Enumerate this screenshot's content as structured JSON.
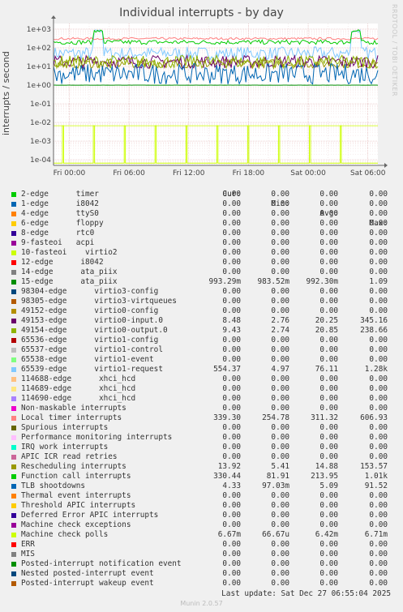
{
  "watermark": "RRDTOOL / TOBI OETIKER",
  "footer": {
    "last_update": "Last update: Sat Dec 27 06:55:04 2025",
    "munin": "Munin 2.0.57"
  },
  "legend_headers": [
    "Cur:",
    "Min:",
    "Avg:",
    "Max:"
  ],
  "chart_data": {
    "type": "line",
    "title": "Individual interrupts - by day",
    "ylabel": "interrupts / second",
    "xlabel": "",
    "yscale": "log",
    "ylim": [
      5e-05,
      2000
    ],
    "yticks": [
      "1e-04",
      "1e-03",
      "1e-02",
      "1e-01",
      "1e+00",
      "1e+01",
      "1e+02",
      "1e+03"
    ],
    "x_range": [
      "Thu 22:25",
      "Sat 07:00"
    ],
    "xticks": [
      "Fri 00:00",
      "Fri 06:00",
      "Fri 12:00",
      "Fri 18:00",
      "Sat 00:00",
      "Sat 06:00"
    ],
    "grid": true,
    "legend_placement": "bottom",
    "series": [
      {
        "name": "2-edge      timer",
        "color": "#00cc00",
        "cur": "0.00",
        "min": "0.00",
        "avg": "0.00",
        "max": "0.00"
      },
      {
        "name": "1-edge      i8042",
        "color": "#0066b3",
        "cur": "0.00",
        "min": "0.00",
        "avg": "0.00",
        "max": "0.00"
      },
      {
        "name": "4-edge      ttyS0",
        "color": "#ff8000",
        "cur": "0.00",
        "min": "0.00",
        "avg": "0.00",
        "max": "0.00"
      },
      {
        "name": "6-edge      floppy",
        "color": "#ffcc00",
        "cur": "0.00",
        "min": "0.00",
        "avg": "0.00",
        "max": "0.00"
      },
      {
        "name": "8-edge      rtc0",
        "color": "#330099",
        "cur": "0.00",
        "min": "0.00",
        "avg": "0.00",
        "max": "0.00"
      },
      {
        "name": "9-fasteoi   acpi",
        "color": "#990099",
        "cur": "0.00",
        "min": "0.00",
        "avg": "0.00",
        "max": "0.00"
      },
      {
        "name": "10-fasteoi    virtio2",
        "color": "#ccff00",
        "cur": "0.00",
        "min": "0.00",
        "avg": "0.00",
        "max": "0.00"
      },
      {
        "name": "12-edge      i8042",
        "color": "#ff0000",
        "cur": "0.00",
        "min": "0.00",
        "avg": "0.00",
        "max": "0.00"
      },
      {
        "name": "14-edge      ata_piix",
        "color": "#808080",
        "cur": "0.00",
        "min": "0.00",
        "avg": "0.00",
        "max": "0.00"
      },
      {
        "name": "15-edge      ata_piix",
        "color": "#008f00",
        "cur": "993.29m",
        "min": "983.52m",
        "avg": "992.30m",
        "max": "1.09"
      },
      {
        "name": "98304-edge      virtio3-config",
        "color": "#00487d",
        "cur": "0.00",
        "min": "0.00",
        "avg": "0.00",
        "max": "0.00"
      },
      {
        "name": "98305-edge      virtio3-virtqueues",
        "color": "#b35a00",
        "cur": "0.00",
        "min": "0.00",
        "avg": "0.00",
        "max": "0.00"
      },
      {
        "name": "49152-edge      virtio0-config",
        "color": "#b38f00",
        "cur": "0.00",
        "min": "0.00",
        "avg": "0.00",
        "max": "0.00"
      },
      {
        "name": "49153-edge      virtio0-input.0",
        "color": "#6b006b",
        "cur": "8.48",
        "min": "2.76",
        "avg": "20.25",
        "max": "345.16"
      },
      {
        "name": "49154-edge      virtio0-output.0",
        "color": "#8fb300",
        "cur": "9.43",
        "min": "2.74",
        "avg": "20.85",
        "max": "238.66"
      },
      {
        "name": "65536-edge      virtio1-config",
        "color": "#b30000",
        "cur": "0.00",
        "min": "0.00",
        "avg": "0.00",
        "max": "0.00"
      },
      {
        "name": "65537-edge      virtio1-control",
        "color": "#bebebe",
        "cur": "0.00",
        "min": "0.00",
        "avg": "0.00",
        "max": "0.00"
      },
      {
        "name": "65538-edge      virtio1-event",
        "color": "#80ff80",
        "cur": "0.00",
        "min": "0.00",
        "avg": "0.00",
        "max": "0.00"
      },
      {
        "name": "65539-edge      virtio1-request",
        "color": "#80c9ff",
        "cur": "554.37",
        "min": "4.97",
        "avg": "76.11",
        "max": "1.28k"
      },
      {
        "name": "114688-edge      xhci_hcd",
        "color": "#ffc080",
        "cur": "0.00",
        "min": "0.00",
        "avg": "0.00",
        "max": "0.00"
      },
      {
        "name": "114689-edge      xhci_hcd",
        "color": "#ffe680",
        "cur": "0.00",
        "min": "0.00",
        "avg": "0.00",
        "max": "0.00"
      },
      {
        "name": "114690-edge      xhci_hcd",
        "color": "#aa80ff",
        "cur": "0.00",
        "min": "0.00",
        "avg": "0.00",
        "max": "0.00"
      },
      {
        "name": "Non-maskable interrupts",
        "color": "#ee00cc",
        "cur": "0.00",
        "min": "0.00",
        "avg": "0.00",
        "max": "0.00"
      },
      {
        "name": "Local timer interrupts",
        "color": "#ff8080",
        "cur": "339.30",
        "min": "254.78",
        "avg": "311.32",
        "max": "606.93"
      },
      {
        "name": "Spurious interrupts",
        "color": "#666600",
        "cur": "0.00",
        "min": "0.00",
        "avg": "0.00",
        "max": "0.00"
      },
      {
        "name": "Performance monitoring interrupts",
        "color": "#ffbfff",
        "cur": "0.00",
        "min": "0.00",
        "avg": "0.00",
        "max": "0.00"
      },
      {
        "name": "IRQ work interrupts",
        "color": "#00ffcc",
        "cur": "0.00",
        "min": "0.00",
        "avg": "0.00",
        "max": "0.00"
      },
      {
        "name": "APIC ICR read retries",
        "color": "#cc6699",
        "cur": "0.00",
        "min": "0.00",
        "avg": "0.00",
        "max": "0.00"
      },
      {
        "name": "Rescheduling interrupts",
        "color": "#999900",
        "cur": "13.92",
        "min": "5.41",
        "avg": "14.88",
        "max": "153.57"
      },
      {
        "name": "Function call interrupts",
        "color": "#00cc00",
        "cur": "330.44",
        "min": "81.91",
        "avg": "213.95",
        "max": "1.01k"
      },
      {
        "name": "TLB shootdowns",
        "color": "#0066b3",
        "cur": "4.33",
        "min": "97.03m",
        "avg": "5.09",
        "max": "91.52"
      },
      {
        "name": "Thermal event interrupts",
        "color": "#ff8000",
        "cur": "0.00",
        "min": "0.00",
        "avg": "0.00",
        "max": "0.00"
      },
      {
        "name": "Threshold APIC interrupts",
        "color": "#ffcc00",
        "cur": "0.00",
        "min": "0.00",
        "avg": "0.00",
        "max": "0.00"
      },
      {
        "name": "Deferred Error APIC interrupts",
        "color": "#330099",
        "cur": "0.00",
        "min": "0.00",
        "avg": "0.00",
        "max": "0.00"
      },
      {
        "name": "Machine check exceptions",
        "color": "#990099",
        "cur": "0.00",
        "min": "0.00",
        "avg": "0.00",
        "max": "0.00"
      },
      {
        "name": "Machine check polls",
        "color": "#ccff00",
        "cur": "6.67m",
        "min": "66.67u",
        "avg": "6.42m",
        "max": "6.71m"
      },
      {
        "name": "ERR",
        "color": "#ff0000",
        "cur": "0.00",
        "min": "0.00",
        "avg": "0.00",
        "max": "0.00"
      },
      {
        "name": "MIS",
        "color": "#808080",
        "cur": "0.00",
        "min": "0.00",
        "avg": "0.00",
        "max": "0.00"
      },
      {
        "name": "Posted-interrupt notification event",
        "color": "#008f00",
        "cur": "0.00",
        "min": "0.00",
        "avg": "0.00",
        "max": "0.00"
      },
      {
        "name": "Nested posted-interrupt event",
        "color": "#00487d",
        "cur": "0.00",
        "min": "0.00",
        "avg": "0.00",
        "max": "0.00"
      },
      {
        "name": "Posted-interrupt wakeup event",
        "color": "#b35a00",
        "cur": "0.00",
        "min": "0.00",
        "avg": "0.00",
        "max": "0.00"
      }
    ]
  }
}
